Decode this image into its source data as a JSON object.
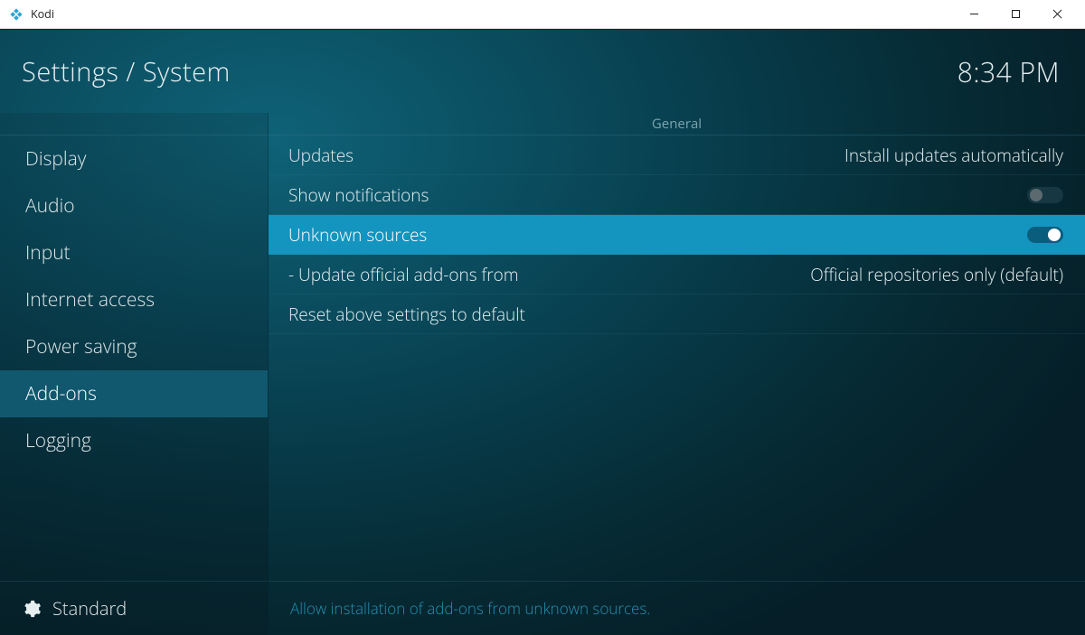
{
  "window": {
    "title": "Kodi"
  },
  "header": {
    "breadcrumb": "Settings / System",
    "clock": "8:34 PM"
  },
  "sidebar": {
    "items": [
      {
        "label": "Display",
        "selected": false
      },
      {
        "label": "Audio",
        "selected": false
      },
      {
        "label": "Input",
        "selected": false
      },
      {
        "label": "Internet access",
        "selected": false
      },
      {
        "label": "Power saving",
        "selected": false
      },
      {
        "label": "Add-ons",
        "selected": true
      },
      {
        "label": "Logging",
        "selected": false
      }
    ],
    "level": {
      "label": "Standard"
    }
  },
  "content": {
    "section": "General",
    "rows": [
      {
        "label": "Updates",
        "type": "select",
        "value": "Install updates automatically",
        "highlighted": false
      },
      {
        "label": "Show notifications",
        "type": "toggle",
        "on": false,
        "highlighted": false
      },
      {
        "label": "Unknown sources",
        "type": "toggle",
        "on": true,
        "highlighted": true
      },
      {
        "label": "- Update official add-ons from",
        "type": "select",
        "value": "Official repositories only (default)",
        "highlighted": false
      },
      {
        "label": "Reset above settings to default",
        "type": "action",
        "highlighted": false
      }
    ],
    "description": "Allow installation of add-ons from unknown sources."
  }
}
